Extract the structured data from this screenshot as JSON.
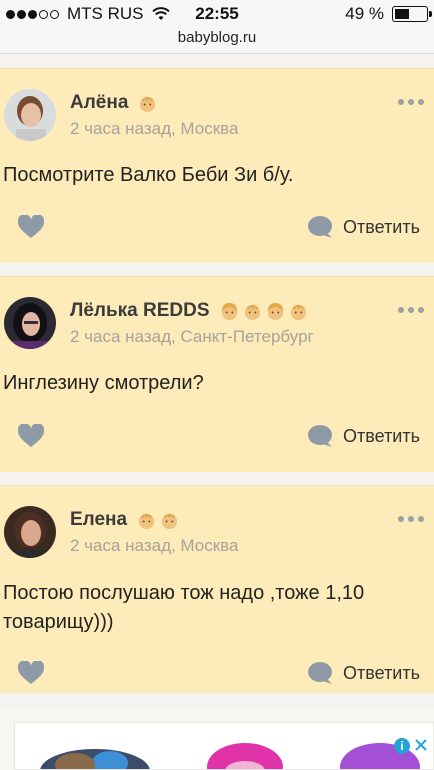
{
  "status_bar": {
    "carrier": "MTS RUS",
    "time": "22:55",
    "battery": "49 %",
    "battery_level": 0.49
  },
  "browser": {
    "url": "babyblog.ru"
  },
  "comments": [
    {
      "author": "Алёна",
      "meta": "2 часа назад, Москва",
      "text": "Посмотрите Валко Беби Зи б/у.",
      "reply_label": "Ответить",
      "badges": [
        "boy-icon"
      ]
    },
    {
      "author": "Лёлька REDDS",
      "meta": "2 часа назад, Санкт-Петербург",
      "text": "Инглезину смотрели?",
      "reply_label": "Ответить",
      "badges": [
        "girl-icon",
        "boy-icon",
        "girl-icon",
        "boy-icon"
      ]
    },
    {
      "author": "Елена",
      "meta": "2 часа назад, Москва",
      "text": "Постою послушаю тож надо ,тоже 1,10 товарищу)))",
      "reply_label": "Ответить",
      "badges": [
        "boy-icon",
        "boy-icon"
      ]
    }
  ],
  "ad": {
    "info_icon": "i"
  },
  "colors": {
    "card_bg": "#fdebb9",
    "icon_gray": "#8e9aa6",
    "meta_text": "#a7a39a"
  }
}
